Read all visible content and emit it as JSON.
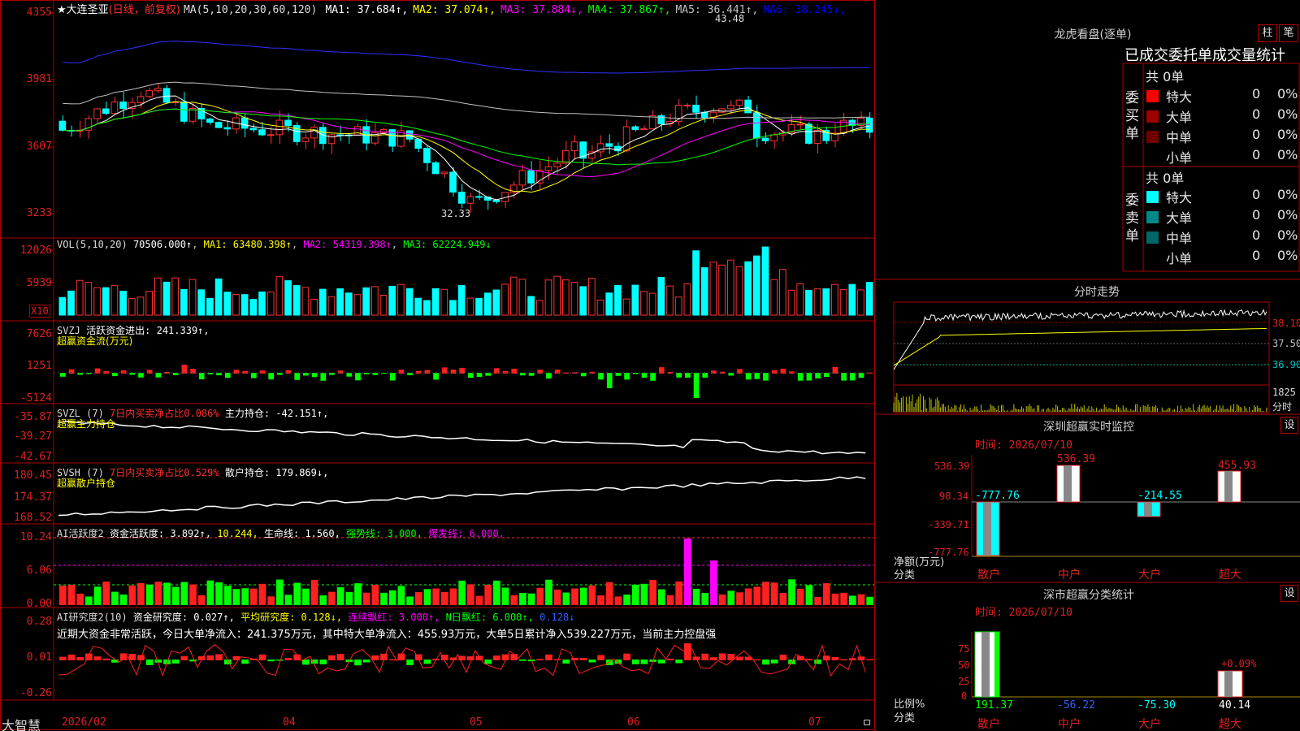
{
  "chart_title": {
    "star": "★",
    "name": "大连圣亚",
    "mode": "(日线，前复权)",
    "ma_label": "MA(5,10,20,30,60,120)",
    "ma_values": [
      {
        "name": "MA1:",
        "value": "37.684↑",
        "color": "#ffffff"
      },
      {
        "name": "MA2:",
        "value": "37.074↑",
        "color": "#ffff00"
      },
      {
        "name": "MA3:",
        "value": "37.884↓",
        "color": "#ff00ff"
      },
      {
        "name": "MA4:",
        "value": "37.867↑",
        "color": "#00ff00"
      },
      {
        "name": "MA5:",
        "value": "36.441↑",
        "color": "#c0c0c0"
      },
      {
        "name": "MA6:",
        "value": "38.245↓",
        "color": "#0000ff"
      }
    ],
    "peak_label": "43.48",
    "low_label": "32.33"
  },
  "price_axis": [
    "4355",
    "3981",
    "3607",
    "3233"
  ],
  "vol_panel": {
    "label": "VOL(5,10,20)",
    "value": "70506.000↑",
    "ma1": "MA1: 63480.398↑",
    "ma2": "MA2: 54319.398↑",
    "ma3": "MA3: 62224.949↓",
    "axis": [
      "12026",
      "5939"
    ],
    "unit": "X10"
  },
  "svzj_panel": {
    "label": "SVZJ",
    "text": "活跃资金进出: 241.339↑,",
    "sub": "超赢资金流(万元)",
    "axis": [
      "7626",
      "1251",
      "-5124"
    ]
  },
  "svzl_panel": {
    "label": "SVZL (7)",
    "red": "7日内买卖净占比0.086%",
    "text": "主力持仓: -42.151↑,",
    "sub": "超赢主力持仓",
    "axis": [
      "-35.87",
      "-39.27",
      "-42.67"
    ]
  },
  "svsh_panel": {
    "label": "SVSH (7)",
    "red": "7日内买卖净占比0.529%",
    "text": "散户持仓: 179.869↓,",
    "sub": "超赢散户持仓",
    "axis": [
      "180.45",
      "174.37",
      "168.52"
    ]
  },
  "ai_panel": {
    "label": "AI活跃度2",
    "t1": "资金活跃度: 3.892↑,",
    "t2": "10.244,",
    "t3": "生命线: 1.560,",
    "t4": "强势线: 3.000,",
    "t5": "爆发线: 6.000,",
    "axis": [
      "10.24",
      "6.06",
      "0.00"
    ]
  },
  "ai2_panel": {
    "label": "AI研究度2(10)",
    "t1": "资金研究度: 0.027↑,",
    "t2": "平均研究度: 0.128↓,",
    "t3": "连续飘红: 3.000↑,",
    "t4": "N日飘红: 6.000↑,",
    "t5": "0.128↓",
    "summary": "近期大资金非常活跃，今日大单净流入：241.375万元，其中特大单净流入：455.93万元，大单5日累计净入539.227万元，当前主力控盘强",
    "axis": [
      "0.28",
      "0.01",
      "-0.26"
    ]
  },
  "date_axis": [
    "2026/02",
    "04",
    "05",
    "06",
    "07"
  ],
  "brand": "大智慧",
  "right": {
    "lhb_title": "龙虎看盘(逐单)",
    "btn1": "柱",
    "btn2": "笔",
    "stats_title": "已成交委托单成交量统计",
    "buy_side": "委买单",
    "sell_side": "委卖单",
    "buy_total": "共 0单",
    "sell_total": "共 0单",
    "buy_rows": [
      {
        "name": "特大",
        "n": "0",
        "p": "0%",
        "color": "#ff0000"
      },
      {
        "name": "大单",
        "n": "0",
        "p": "0%",
        "color": "#a00000"
      },
      {
        "name": "中单",
        "n": "0",
        "p": "0%",
        "color": "#700000"
      },
      {
        "name": "小单",
        "n": "0",
        "p": "0%",
        "color": "#000000"
      }
    ],
    "sell_rows": [
      {
        "name": "特大",
        "n": "0",
        "p": "0%",
        "color": "#00ffff"
      },
      {
        "name": "大单",
        "n": "0",
        "p": "0%",
        "color": "#008888"
      },
      {
        "name": "中单",
        "n": "0",
        "p": "0%",
        "color": "#006666"
      },
      {
        "name": "小单",
        "n": "0",
        "p": "0%",
        "color": "#000000"
      }
    ],
    "fenshi_title": "分时走势",
    "fenshi_axis": [
      "38.10",
      "37.50",
      "36.90"
    ],
    "fenshi_vol": "1825",
    "fenshi_unit": "分时",
    "monitor_title": "深圳超赢实时监控",
    "set_btn": "设",
    "monitor_time": "时间: 2026/07/10",
    "monitor_axis": [
      "536.39",
      "98.34",
      "-339.71",
      "-777.76"
    ],
    "monitor_unit": "净额(万元)",
    "monitor_cat": "分类",
    "monitor_cats": [
      "散户",
      "中户",
      "大户",
      "超大"
    ],
    "monitor_values": [
      "-777.76",
      "536.39",
      "-214.55",
      "455.93"
    ],
    "class_title": "深市超赢分类统计",
    "class_time": "时间: 2026/07/10",
    "class_axis": [
      "75",
      "50",
      "25",
      "0"
    ],
    "class_unit": "比例%",
    "class_cat": "分类",
    "class_cats": [
      "散户",
      "中户",
      "大户",
      "超大"
    ],
    "class_values": [
      "191.37",
      "-56.22",
      "-75.30",
      "40.14"
    ],
    "class_pct": "+0.09%"
  }
}
